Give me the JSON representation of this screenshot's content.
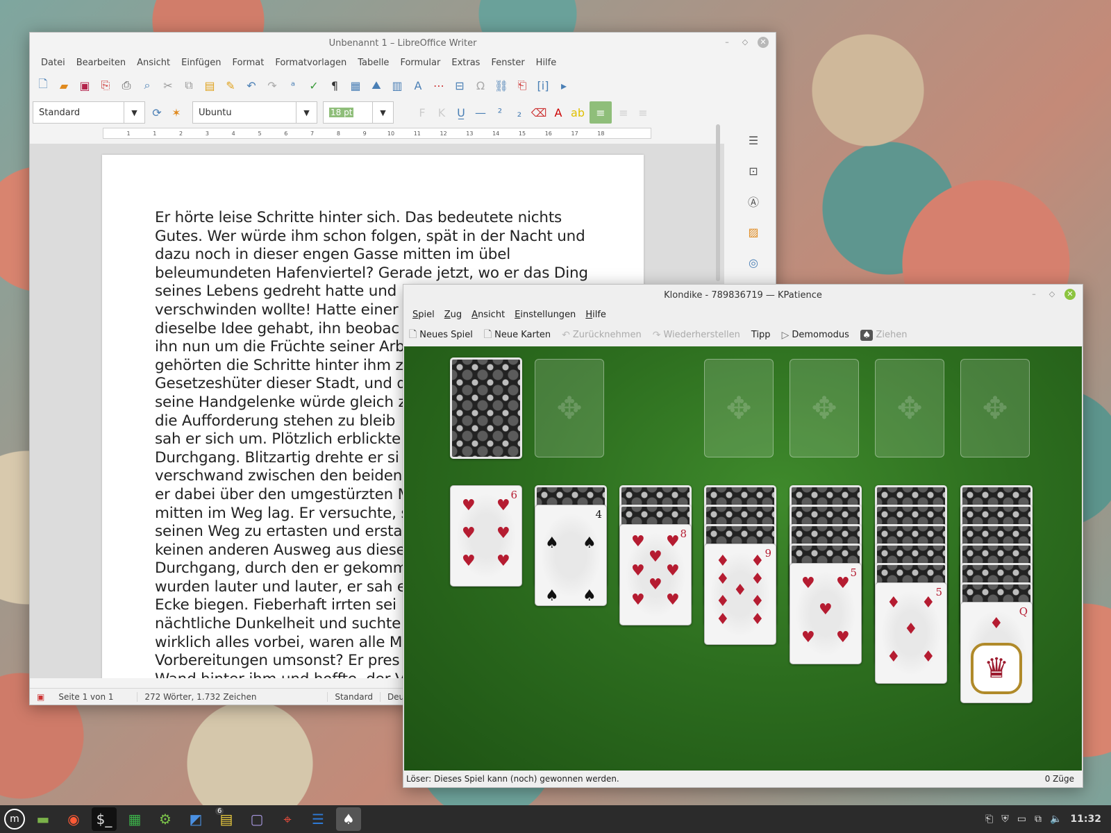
{
  "writer": {
    "title": "Unbenannt 1 – LibreOffice Writer",
    "menu": [
      "Datei",
      "Bearbeiten",
      "Ansicht",
      "Einfügen",
      "Format",
      "Formatvorlagen",
      "Tabelle",
      "Formular",
      "Extras",
      "Fenster",
      "Hilfe"
    ],
    "paragraph_style": "Standard",
    "font_name": "Ubuntu",
    "font_size": "18 pt",
    "ruler_numbers": [
      "1",
      "1",
      "2",
      "3",
      "4",
      "5",
      "6",
      "7",
      "8",
      "9",
      "10",
      "11",
      "12",
      "13",
      "14",
      "15",
      "16",
      "17",
      "18"
    ],
    "document_text": "Er hörte leise Schritte hinter sich. Das bedeutete nichts\nGutes. Wer würde ihm schon folgen, spät in der Nacht und\ndazu noch in dieser engen Gasse mitten im übel\nbeleumundeten Hafenviertel? Gerade jetzt, wo er das Ding\nseines Lebens gedreht hatte und\nverschwinden wollte! Hatte einer\ndieselbe Idee gehabt, ihn beobac\nihn nun um die Früchte seiner Arb\ngehörten die Schritte hinter ihm z\nGesetzeshüter dieser Stadt, und d\nseine Handgelenke würde gleich z\ndie Aufforderung stehen zu bleib\nsah er sich um. Plötzlich erblickte\nDurchgang. Blitzartig drehte er si\nverschwand zwischen den beiden\ner dabei über den umgestürzten M\nmitten im Weg lag. Er versuchte, s\nseinen Weg zu ertasten und ersta\nkeinen anderen Ausweg aus diese\nDurchgang, durch den er gekomm\nwurden lauter und lauter, er sah e\nEcke biegen. Fieberhaft irrten sei\nnächtliche Dunkelheit und suchte\nwirklich alles vorbei, waren alle M\nVorbereitungen umsonst? Er pres\nWand hinter ihm und hoffte, der V",
    "status": {
      "page": "Seite 1 von 1",
      "words": "272 Wörter, 1.732 Zeichen",
      "style": "Standard",
      "language": "Deutsc"
    }
  },
  "kpatience": {
    "title": "Klondike - 789836719 — KPatience",
    "menu": [
      {
        "key": "S",
        "rest": "piel"
      },
      {
        "key": "Z",
        "rest": "ug"
      },
      {
        "key": "A",
        "rest": "nsicht"
      },
      {
        "key": "E",
        "rest": "instellungen"
      },
      {
        "key": "H",
        "rest": "ilfe"
      }
    ],
    "toolbar": {
      "new_game": "Neues Spiel",
      "new_cards": "Neue Karten",
      "undo": "Zurücknehmen",
      "redo": "Wiederherstellen",
      "hint": "Tipp",
      "demo": "Demomodus",
      "draw": "Ziehen"
    },
    "tableau": [
      {
        "rank": "6",
        "suit": "♥",
        "color": "red",
        "hidden": 0
      },
      {
        "rank": "4",
        "suit": "♠",
        "color": "black",
        "hidden": 1
      },
      {
        "rank": "8",
        "suit": "♥",
        "color": "red",
        "hidden": 2
      },
      {
        "rank": "9",
        "suit": "♦",
        "color": "red",
        "hidden": 3
      },
      {
        "rank": "5",
        "suit": "♥",
        "color": "red",
        "hidden": 4
      },
      {
        "rank": "5",
        "suit": "♦",
        "color": "red",
        "hidden": 5
      },
      {
        "rank": "Q",
        "suit": "♦",
        "color": "red",
        "hidden": 6
      }
    ],
    "status_left": "Löser: Dieses Spiel kann (noch) gewonnen werden.",
    "status_right": "0 Züge"
  },
  "taskbar": {
    "notes_badge": "6",
    "clock": "11:32"
  },
  "icons": [
    "mint-menu-icon",
    "files-icon",
    "firefox-icon",
    "terminal-icon",
    "calc-icon",
    "settings-icon",
    "finder-icon",
    "notes-icon",
    "editor-icon",
    "maps-icon",
    "writer-icon",
    "kpatience-icon"
  ]
}
